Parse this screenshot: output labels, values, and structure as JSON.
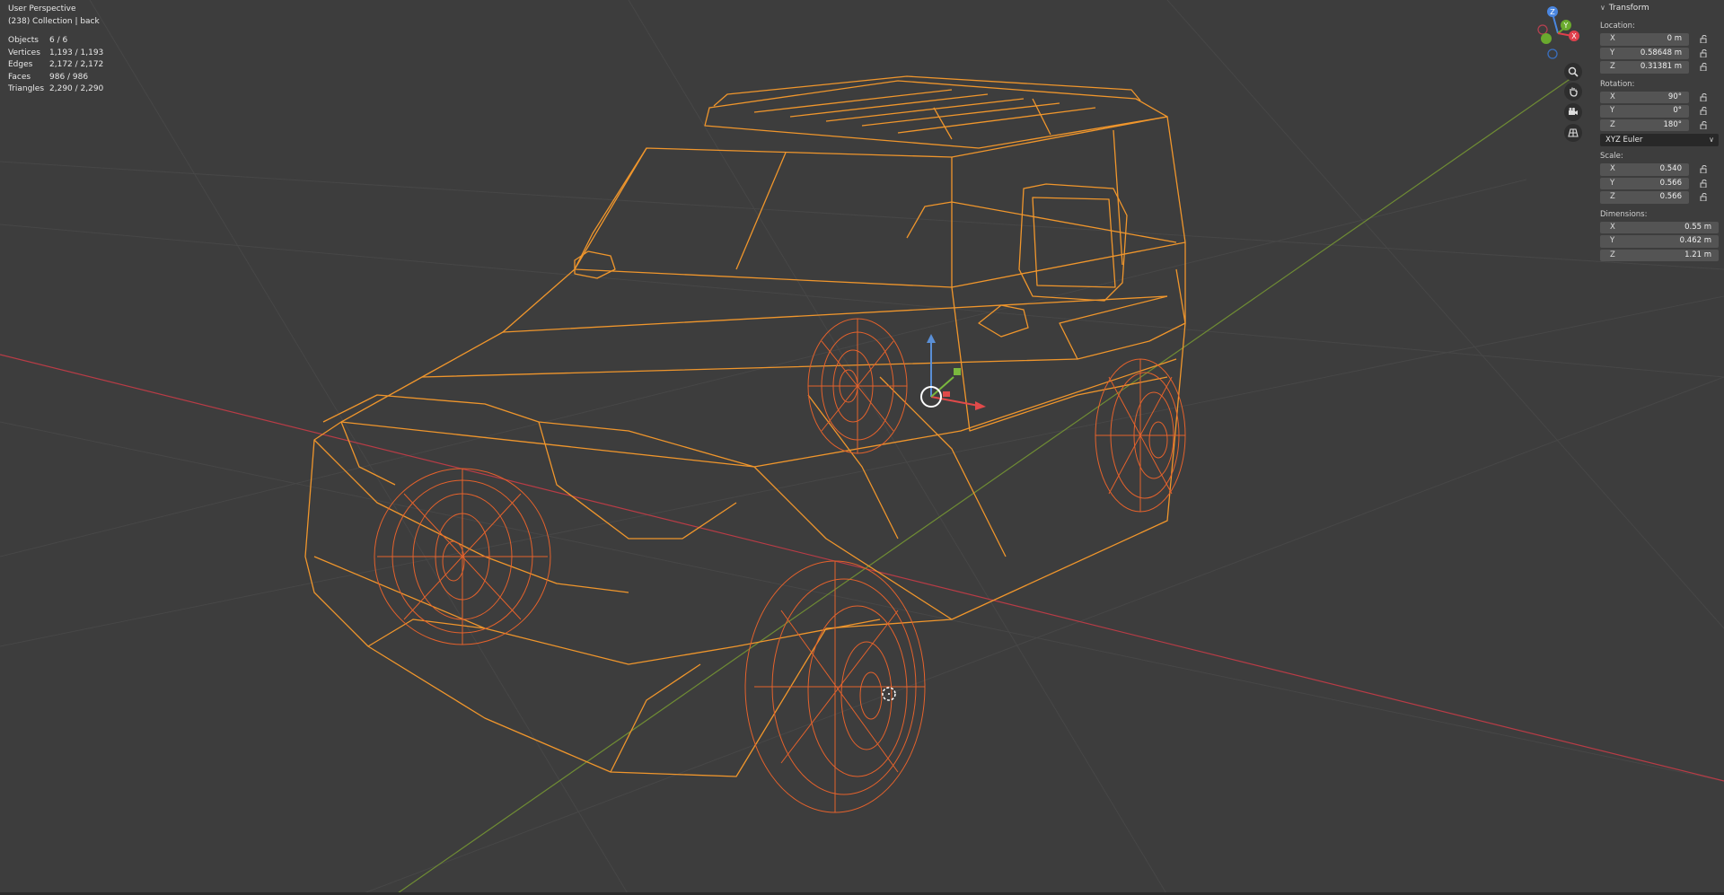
{
  "viewport": {
    "view_name": "User Perspective",
    "collection_line": "(238) Collection | back",
    "stats": [
      {
        "label": "Objects",
        "value": "6 / 6"
      },
      {
        "label": "Vertices",
        "value": "1,193 / 1,193"
      },
      {
        "label": "Edges",
        "value": "2,172 / 2,172"
      },
      {
        "label": "Faces",
        "value": "986 / 986"
      },
      {
        "label": "Triangles",
        "value": "2,290 / 2,290"
      }
    ]
  },
  "gizmo": {
    "z": "Z",
    "y": "Y",
    "x": "X"
  },
  "nav_tools": [
    "zoom-icon",
    "hand-pan-icon",
    "camera-icon",
    "grid-perspective-icon"
  ],
  "transform": {
    "header": "Transform",
    "location_label": "Location:",
    "location": [
      {
        "axis": "X",
        "value": "0 m"
      },
      {
        "axis": "Y",
        "value": "0.58648 m"
      },
      {
        "axis": "Z",
        "value": "0.31381 m"
      }
    ],
    "rotation_label": "Rotation:",
    "rotation": [
      {
        "axis": "X",
        "value": "90°"
      },
      {
        "axis": "Y",
        "value": "0°"
      },
      {
        "axis": "Z",
        "value": "180°"
      }
    ],
    "rotation_mode": "XYZ Euler",
    "scale_label": "Scale:",
    "scale": [
      {
        "axis": "X",
        "value": "0.540"
      },
      {
        "axis": "Y",
        "value": "0.566"
      },
      {
        "axis": "Z",
        "value": "0.566"
      }
    ],
    "dimensions_label": "Dimensions:",
    "dimensions": [
      {
        "axis": "X",
        "value": "0.55 m"
      },
      {
        "axis": "Y",
        "value": "0.462 m"
      },
      {
        "axis": "Z",
        "value": "1.21 m"
      }
    ]
  },
  "colors": {
    "background": "#3d3d3d",
    "wire_body": "#f0962c",
    "wire_wheel": "#e8602a",
    "x_axis": "#c8414b",
    "y_axis": "#7a9a3a"
  }
}
